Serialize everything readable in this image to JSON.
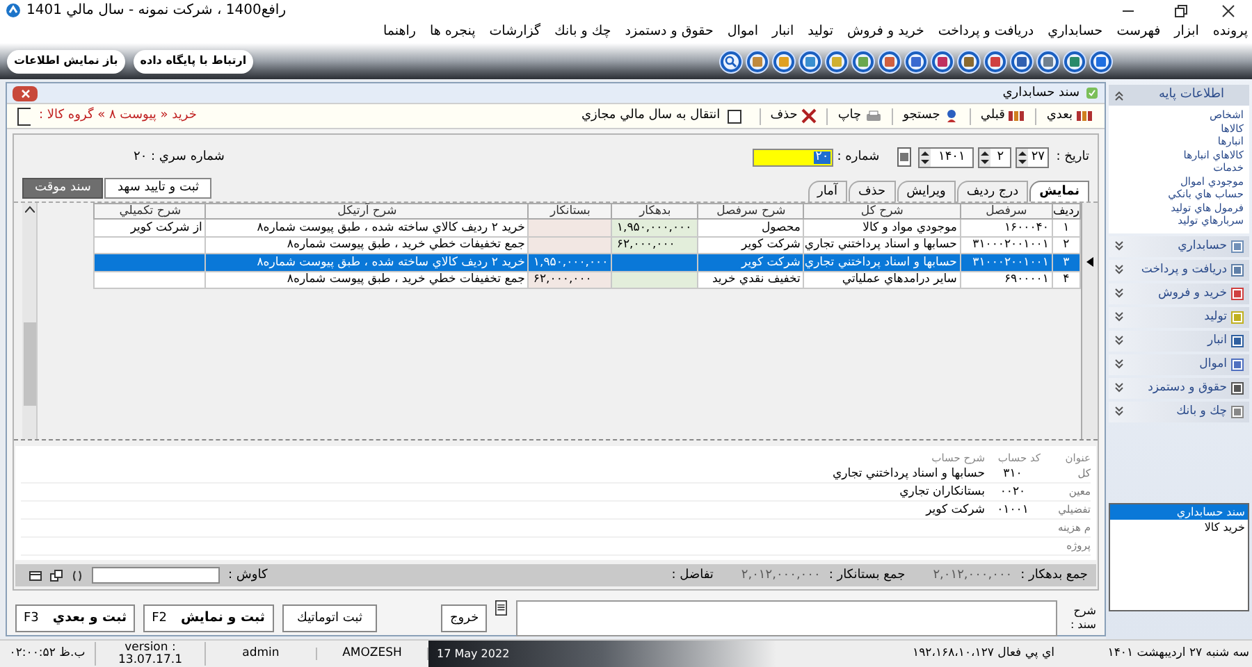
{
  "window": {
    "title": "رافع1400 ، شركت نمونه - سال مالي 1401"
  },
  "menu": [
    "پرونده",
    "ابزار",
    "فهرست",
    "حسابداري",
    "دريافت و پرداخت",
    "خريد و فروش",
    "توليد",
    "انبار",
    "اموال",
    "حقوق و دستمزد",
    "چك و بانك",
    "گزارشات",
    "پنجره ها",
    "راهنما"
  ],
  "toolbar": {
    "buttons": [
      "ارتباط با پايگاه داده",
      "باز نمايش اطلاعات"
    ]
  },
  "document": {
    "title": "سند حسابداري",
    "actions": [
      "بعدي",
      "قبلي",
      "جستجو",
      "چاپ",
      "حذف"
    ],
    "transfer": {
      "label": "انتقال به سال مالي مجازي",
      "checked": false
    },
    "path": "خريد « پيوست ۸ » گروه كالا :",
    "date_label": "تاريخ :",
    "date": {
      "day": "۲۷",
      "month": "۲",
      "year": "۱۴۰۱"
    },
    "number_label": "شماره :",
    "number": "۲۰",
    "series": "شماره سري : ۲۰",
    "tabs": [
      {
        "label": "نمايش",
        "selected": true
      },
      {
        "label": "درج رديف",
        "selected": false
      },
      {
        "label": "ويرايش",
        "selected": false
      },
      {
        "label": "حذف",
        "selected": false
      },
      {
        "label": "آمار",
        "selected": false
      }
    ],
    "buttons": [
      {
        "label": "ثبت و تاييد سهد",
        "kind": "normal"
      },
      {
        "label": "سند موقت",
        "kind": "dark"
      }
    ],
    "table": {
      "columns": [
        "رديف",
        "سرفصل",
        "شرح كل",
        "شرح سرفصل",
        "بدهكار",
        "بستانكار",
        "شرح آرتيكل",
        "شرح تكميلي"
      ],
      "rows": [
        {
          "number": "۱",
          "code": "۱۶۰۰۰۴۰",
          "account": "موجودي مواد و كالا",
          "sub_account": "محصول",
          "debit": "۱,۹۵۰,۰۰۰,۰۰۰",
          "description": "خريد ۲ رديف كالاي ساخته شده ، طبق پيوست شماره۸",
          "note": "از شركت كوير",
          "selected": false
        },
        {
          "number": "۲",
          "code": "۳۱۰۰۰۲۰۰۱۰۰۱",
          "account": "حسابها و اسناد پرداختني تجاري",
          "sub_account": "شركت كوير",
          "debit": "۶۲,۰۰۰,۰۰۰",
          "description": "جمع تخفيفات خطي خريد ، طبق پيوست شماره۸",
          "selected": false
        },
        {
          "number": "۳",
          "code": "۳۱۰۰۰۲۰۰۱۰۰۱",
          "account": "حسابها و اسناد پرداختني تجاري",
          "sub_account": "شركت كوير",
          "credit": "۱,۹۵۰,۰۰۰,۰۰۰",
          "description": "خريد ۲ رديف كالاي ساخته شده ، طبق پيوست شماره۸",
          "selected": true
        },
        {
          "number": "۴",
          "code": "۶۹۰۰۰۰۱",
          "account": "ساير درآمدهاي عملياتي",
          "sub_account": "تخفيف نقدي خريد",
          "credit": "۶۲,۰۰۰,۰۰۰",
          "description": "جمع تخفيفات خطي خريد ، طبق پيوست شماره۸",
          "selected": false
        }
      ]
    },
    "account_details": {
      "headers": [
        "عنوان",
        "كد حساب",
        "شرح حساب"
      ],
      "rows": [
        {
          "label": "كل",
          "code": "۳۱۰",
          "description": "حسابها و اسناد پرداختني تجاري"
        },
        {
          "label": "معين",
          "code": "۰۰۲۰",
          "description": "بستانكاران تجاري"
        },
        {
          "label": "تفضيلي",
          "code": "۰۱۰۰۱",
          "description": "شركت كوير"
        },
        {
          "label": "م هزينه"
        },
        {
          "label": "پروژه"
        }
      ]
    },
    "totals": {
      "debit_label": "جمع بدهكار :",
      "debit": "۲,۰۱۲,۰۰۰,۰۰۰",
      "credit_label": "جمع بستانكار :",
      "credit": "۲,۰۱۲,۰۰۰,۰۰۰",
      "difference_label": "تفاضل :",
      "search_label": "كاوش :"
    },
    "description_label": "شرح سند :",
    "bottom_buttons": [
      {
        "label": "خروج"
      },
      {
        "label": "ثبت اتوماتيك"
      },
      {
        "label": "ثبت و نمايش",
        "shortcut": "F2"
      },
      {
        "label": "ثبت و بعدي",
        "shortcut": "F3"
      }
    ]
  },
  "sidebar": {
    "sections": [
      {
        "label": "اطلاعات پايه",
        "expanded": true,
        "items": [
          "اشخاص",
          "كالاها",
          "انبارها",
          "كالاهاي انبارها",
          "خدمات",
          "موجودي اموال",
          "حساب هاي بانكي",
          "فرمول هاي توليد",
          "سربارهاي توليد"
        ]
      },
      {
        "label": "حسابداري",
        "expanded": false
      },
      {
        "label": "دريافت و پرداخت",
        "expanded": false
      },
      {
        "label": "خريد و فروش",
        "expanded": false
      },
      {
        "label": "توليد",
        "expanded": false
      },
      {
        "label": "انبار",
        "expanded": false
      },
      {
        "label": "اموال",
        "expanded": false
      },
      {
        "label": "حقوق و دستمزد",
        "expanded": false
      },
      {
        "label": "چك و بانك",
        "expanded": false
      }
    ],
    "open_windows": [
      {
        "label": "سند حسابداري",
        "selected": true
      },
      {
        "label": "خريد كالا",
        "selected": false
      }
    ]
  },
  "status_bar": {
    "time": "۰۲:۰۰:۵۲ ب.ظ",
    "version": "version : 13.07.17.1",
    "user": "admin",
    "database": "AMOZESH",
    "date": "17 May 2022",
    "ip": "اي پي فعال ۱۹۲،۱۶۸،۱۰،۱۲۷",
    "day": "سه شنبه ۲۷ ارديبهشت ۱۴۰۱"
  }
}
